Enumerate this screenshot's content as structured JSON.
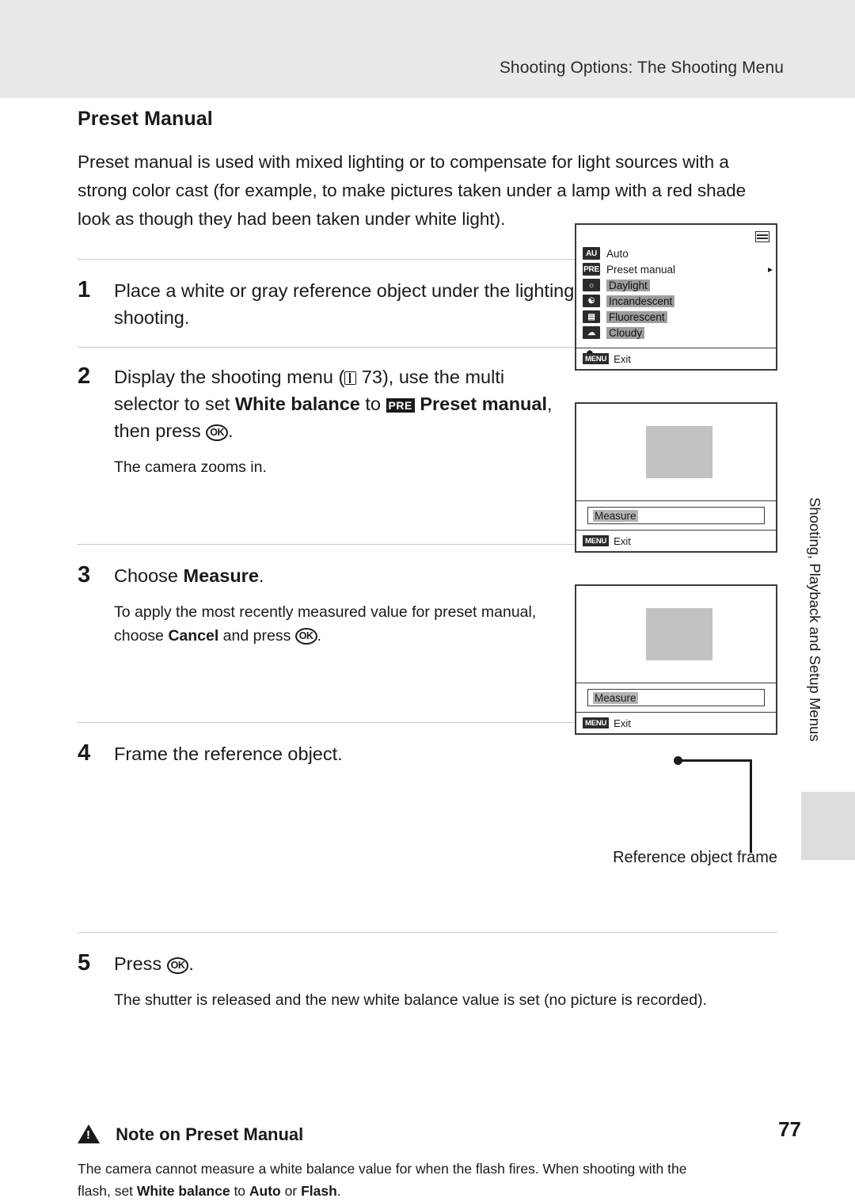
{
  "header": {
    "title": "Shooting Options: The Shooting Menu"
  },
  "side_tab": {
    "label": "Shooting, Playback and Setup Menus"
  },
  "section": {
    "title": "Preset Manual",
    "intro": "Preset manual is used with mixed lighting or to compensate for light sources with a strong color cast (for example, to make pictures taken under a lamp with a red shade look as though they had been taken under white light)."
  },
  "steps": [
    {
      "number": "1",
      "head_plain": "Place a white or gray reference object under the lighting that will be used during shooting.",
      "sub": ""
    },
    {
      "number": "2",
      "head_part1": "Display the shooting menu (",
      "head_page": " 73), use the multi selector to set ",
      "head_bold1": "White balance",
      "head_part2": " to ",
      "head_bold2": "Preset manual",
      "head_part3": ", then press ",
      "head_end": ".",
      "sub": "The camera zooms in."
    },
    {
      "number": "3",
      "head_part1": "Choose ",
      "head_bold1": "Measure",
      "head_part2": ".",
      "sub_part1": "To apply the most recently measured value for preset manual, choose ",
      "sub_bold1": "Cancel",
      "sub_part2": " and press ",
      "sub_end": "."
    },
    {
      "number": "4",
      "head_plain": "Frame the reference object.",
      "sub": ""
    },
    {
      "number": "5",
      "head_part1": "Press ",
      "head_part2": ".",
      "sub": "The shutter is released and the new white balance value is set (no picture is recorded)."
    }
  ],
  "lcd_menu": {
    "rows": [
      {
        "icon": "AUTO",
        "label": "Auto",
        "selected": false,
        "arrow": false
      },
      {
        "icon": "PRE",
        "label": "Preset manual",
        "selected": false,
        "arrow": true
      },
      {
        "icon": "sun",
        "label": "Daylight",
        "selected": true,
        "arrow": false
      },
      {
        "icon": "bulb",
        "label": "Incandescent",
        "selected": true,
        "arrow": false
      },
      {
        "icon": "tube",
        "label": "Fluorescent",
        "selected": true,
        "arrow": false
      },
      {
        "icon": "cloud",
        "label": "Cloudy",
        "selected": true,
        "arrow": false
      }
    ],
    "exit_badge": "MENU",
    "exit_label": "Exit"
  },
  "lcd_shot": {
    "measure_label": "Measure",
    "exit_badge": "MENU",
    "exit_label": "Exit"
  },
  "reference_caption": "Reference object frame",
  "note": {
    "title": "Note on Preset Manual",
    "line1": "The camera cannot measure a white balance value for when the flash fires. When shooting with the",
    "line2_part1": "flash, set ",
    "line2_bold1": "White balance",
    "line2_part2": " to ",
    "line2_bold2": "Auto",
    "line2_part3": " or ",
    "line2_bold3": "Flash",
    "line2_end": "."
  },
  "page_number": "77"
}
